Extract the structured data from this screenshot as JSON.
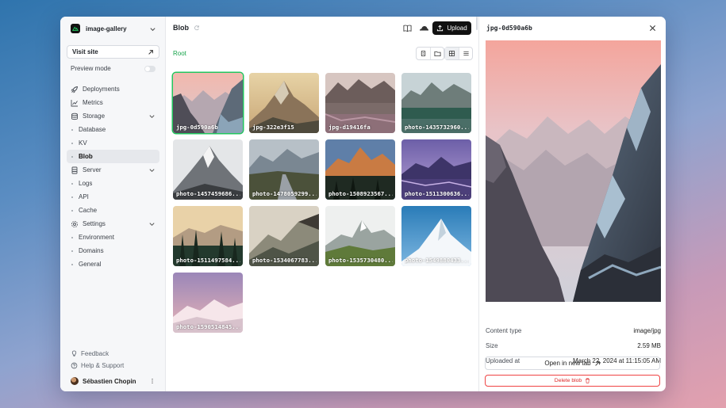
{
  "project": {
    "name": "image-gallery"
  },
  "sidebar": {
    "visit_label": "Visit site",
    "preview_label": "Preview mode",
    "items": [
      {
        "label": "Deployments",
        "icon": "rocket-icon"
      },
      {
        "label": "Metrics",
        "icon": "chart-line-icon"
      },
      {
        "label": "Storage",
        "icon": "database-icon"
      },
      {
        "label": "Database"
      },
      {
        "label": "KV"
      },
      {
        "label": "Blob"
      },
      {
        "label": "Server",
        "icon": "server-icon"
      },
      {
        "label": "Logs"
      },
      {
        "label": "API"
      },
      {
        "label": "Cache"
      },
      {
        "label": "Settings",
        "icon": "gear-icon"
      },
      {
        "label": "Environment"
      },
      {
        "label": "Domains"
      },
      {
        "label": "General"
      }
    ],
    "feedback": "Feedback",
    "help": "Help & Support",
    "user": "Sébastien Chopin"
  },
  "main": {
    "title": "Blob",
    "upload_label": "Upload",
    "breadcrumb": "Root",
    "files": [
      "jpg-0d590a6b",
      "jpg-322e3f15",
      "jpg-d19416fa",
      "photo-1435732960...",
      "photo-1457459686...",
      "photo-1478059299...",
      "photo-1508923567...",
      "photo-1511300636...",
      "photo-1511497584...",
      "photo-1534067783...",
      "photo-1535730480...",
      "photo-1549880433...",
      "photo-1590514845..."
    ]
  },
  "detail": {
    "title": "jpg-0d590a6b",
    "content_type_label": "Content type",
    "content_type": "image/jpg",
    "size_label": "Size",
    "size": "2.59 MB",
    "uploaded_label": "Uploaded at",
    "uploaded": "March 22, 2024 at 11:15:05 AM",
    "open_label": "Open in new tab",
    "delete_label": "Delete blob"
  },
  "colors": {
    "accent": "#16a34a",
    "selection": "#22c55e",
    "danger": "#dc2626",
    "primary": "#111111"
  }
}
